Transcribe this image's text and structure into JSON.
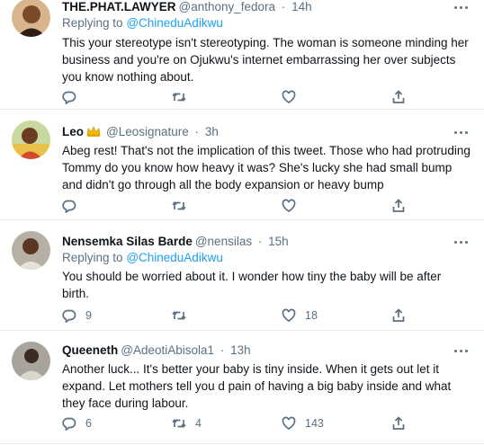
{
  "tweets": [
    {
      "name": "THE.PHAT.LAWYER",
      "handle": "@anthony_fedora",
      "time": "14h",
      "replying_prefix": "Replying to",
      "replying_to": "@ChineduAdikwu",
      "text": "This your stereotype isn't stereotyping. The woman is someone minding her business and you're on Ojukwu's internet embarrassing her over subjects you know nothing about.",
      "replies": "",
      "retweets": "",
      "likes": ""
    },
    {
      "name": "Leo",
      "handle": "@Leosignature",
      "time": "3h",
      "text": "Abeg rest! That's not the implication of this tweet. Those who had protruding Tommy do you know how heavy it was? She's lucky she had small bump and didn't go through all the body expansion or heavy bump",
      "replies": "",
      "retweets": "",
      "likes": ""
    },
    {
      "name": "Nensemka Silas Barde",
      "handle": "@nensilas",
      "time": "15h",
      "replying_prefix": "Replying to",
      "replying_to": "@ChineduAdikwu",
      "text": "You should be worried about it. I wonder how tiny the baby will be after birth.",
      "replies": "9",
      "retweets": "",
      "likes": "18"
    },
    {
      "name": "Queeneth",
      "handle": "@AdeotiAbisola1",
      "time": "13h",
      "text": "Another luck... It's  better your baby is tiny inside. When it gets out let it expand. Let mothers tell you d pain of having a big baby inside and what they face during labour.",
      "replies": "6",
      "retweets": "4",
      "likes": "143"
    }
  ],
  "separator": "·",
  "colors": {
    "link": "#1da1f2",
    "muted": "#5b7083",
    "text": "#0f1419",
    "divider": "#e6ecf0"
  },
  "icons": [
    "more-icon",
    "reply-icon",
    "retweet-icon",
    "like-icon",
    "share-icon",
    "crown-icon"
  ]
}
